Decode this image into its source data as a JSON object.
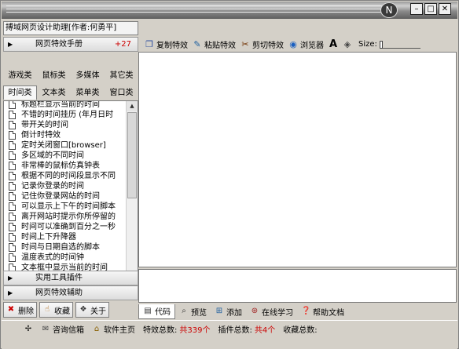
{
  "app": {
    "title": "搏域网页设计助理[作者:何勇平]",
    "window_buttons": [
      "–",
      "□",
      "✕"
    ]
  },
  "left": {
    "handbook": {
      "label": "网页特效手册",
      "count": "+27"
    },
    "categories_row1": [
      "游戏类",
      "鼠标类",
      "多媒体",
      "其它类"
    ],
    "categories_row2": [
      "时间类",
      "文本类",
      "菜单类",
      "窗口类"
    ],
    "items": [
      "标题栏显示当前的时间",
      "不错的时间挂历 (年月日时",
      "带开关的时间",
      "倒计时特效",
      "定时关闭窗口[browser]",
      "多区域的不同时间",
      "非常棒的鼠标仿真钟表",
      "根据不同的时间段显示不同",
      "记录你登录的时间",
      "记住你登录网站的时间",
      "可以显示上下午的时间脚本",
      "离开网站时提示你所停留的",
      "时间可以准确到百分之一秒",
      "时间上下升降器",
      "时间与日期自选的脚本",
      "温度表式的时间钟",
      "文本框中显示当前的时间"
    ],
    "tools": "实用工具插件",
    "assist": "网页特效辅助",
    "buttons": {
      "delete": "删除",
      "collect": "收藏",
      "about": "关于"
    }
  },
  "toolbar": {
    "copy": "复制特效",
    "paste": "粘贴特效",
    "cut": "剪切特效",
    "browser": "浏览器",
    "size_label": "Size:"
  },
  "tabs": {
    "code": "代码",
    "preview": "预览",
    "add": "添加",
    "learn": "在线学习",
    "help": "帮助文档"
  },
  "status": {
    "consult": "咨询信箱",
    "homepage": "软件主页",
    "effects_label": "特效总数:",
    "effects_value": "共339个",
    "plugins_label": "插件总数:",
    "plugins_value": "共4个",
    "favorites_label": "收藏总数:"
  }
}
